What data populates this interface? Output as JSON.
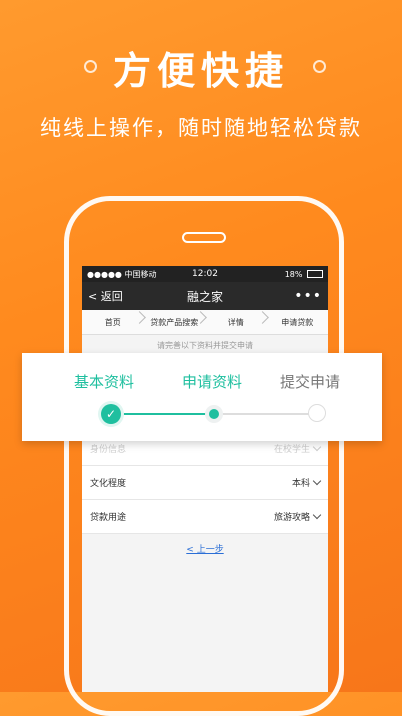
{
  "promo": {
    "headline": "方便快捷",
    "subline": "纯线上操作，随时随地轻松贷款"
  },
  "status_bar": {
    "carrier": "●●●●● 中国移动",
    "time": "12:02",
    "battery": "18%"
  },
  "nav": {
    "back_label": "< 返回",
    "title": "融之家",
    "more_label": "•••"
  },
  "breadcrumbs": [
    "首页",
    "贷款产品搜索",
    "详情",
    "申请贷款"
  ],
  "notice": "请完善以下资料并提交申请",
  "steps": {
    "items": [
      "基本资料",
      "申请资料",
      "提交申请"
    ],
    "current_index": 1
  },
  "form": {
    "rows": [
      {
        "label": "身份信息",
        "value": "在校学生"
      },
      {
        "label": "文化程度",
        "value": "本科"
      },
      {
        "label": "贷款用途",
        "value": "旅游攻略"
      }
    ],
    "prev_link": "< 上一步"
  },
  "colors": {
    "background": "#ff8a1e",
    "accent": "#1fbf9f",
    "link": "#2a6ed6"
  }
}
